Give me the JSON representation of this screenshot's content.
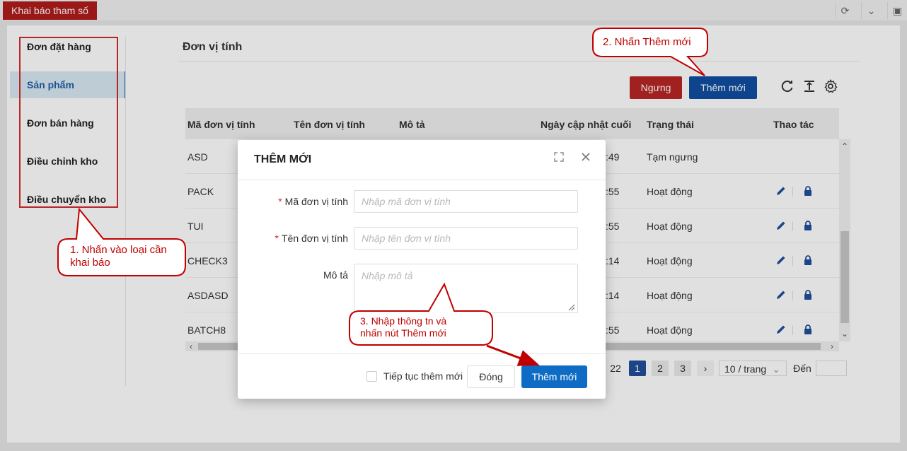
{
  "topbar": {
    "tab_label": "Khai báo tham số"
  },
  "sidebar": {
    "items": [
      {
        "label": "Đơn đặt hàng"
      },
      {
        "label": "Sản phẩm"
      },
      {
        "label": "Đơn bán hàng"
      },
      {
        "label": "Điều chỉnh kho"
      },
      {
        "label": "Điều chuyển kho"
      }
    ]
  },
  "main": {
    "title": "Đơn vị tính",
    "stop_label": "Ngưng",
    "add_label": "Thêm mới",
    "columns": [
      "Mã đơn vị tính",
      "Tên đơn vị tính",
      "Mô tả",
      "Ngày cập nhật cuối",
      "Trạng thái",
      "Thao tác"
    ],
    "rows": [
      {
        "code": "ASD",
        "time": ":49",
        "status": "Tạm ngưng"
      },
      {
        "code": "PACK",
        "time": ":55",
        "status": "Hoạt động"
      },
      {
        "code": "TUI",
        "time": ":55",
        "status": "Hoạt động"
      },
      {
        "code": "CHECK3",
        "time": ":14",
        "status": "Hoạt động"
      },
      {
        "code": "ASDASD",
        "time": ":14",
        "status": "Hoạt động"
      },
      {
        "code": "BATCH8",
        "time": ":55",
        "status": "Hoạt động"
      }
    ]
  },
  "pagination": {
    "total_partial": "22",
    "pages": [
      "1",
      "2",
      "3"
    ],
    "page_size": "10 / trang",
    "goto_label": "Đến"
  },
  "modal": {
    "title": "THÊM MỚI",
    "field_code_label": "Mã đơn vị tính",
    "field_code_placeholder": "Nhập mã đơn vị tính",
    "field_name_label": "Tên đơn vị tính",
    "field_name_placeholder": "Nhập tên đơn vị tính",
    "field_desc_label": "Mô tả",
    "field_desc_placeholder": "Nhập mô tả",
    "continue_label": "Tiếp tục thêm mới",
    "close_label": "Đóng",
    "add_label": "Thêm mới"
  },
  "callouts": {
    "c1": "1. Nhấn vào loại cần khai báo",
    "c2": "2. Nhấn Thêm mới",
    "c3": "3. Nhập thông tn và nhấn nút Thêm mới"
  }
}
